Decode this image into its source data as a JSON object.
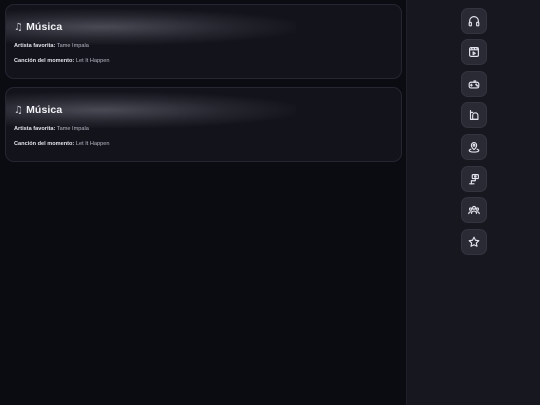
{
  "cards": [
    {
      "title": "Música",
      "artist_label": "Artista favorita:",
      "artist_value": "Tame Impala",
      "song_label": "Canción del momento:",
      "song_value": "Let It Happen"
    },
    {
      "title": "Música",
      "artist_label": "Artista favorita:",
      "artist_value": "Tame Impala",
      "song_label": "Canción del momento:",
      "song_value": "Let It Happen"
    }
  ],
  "sidebar": {
    "icons": [
      "headphones-icon",
      "film-icon",
      "gamepad-icon",
      "food-icon",
      "map-pin-icon",
      "camera-icon",
      "group-icon",
      "star-icon"
    ]
  },
  "colors": {
    "background": "#0b0b12",
    "sidebar": "#171720",
    "card": "#13131b",
    "icon_button": "#2a2a35"
  }
}
